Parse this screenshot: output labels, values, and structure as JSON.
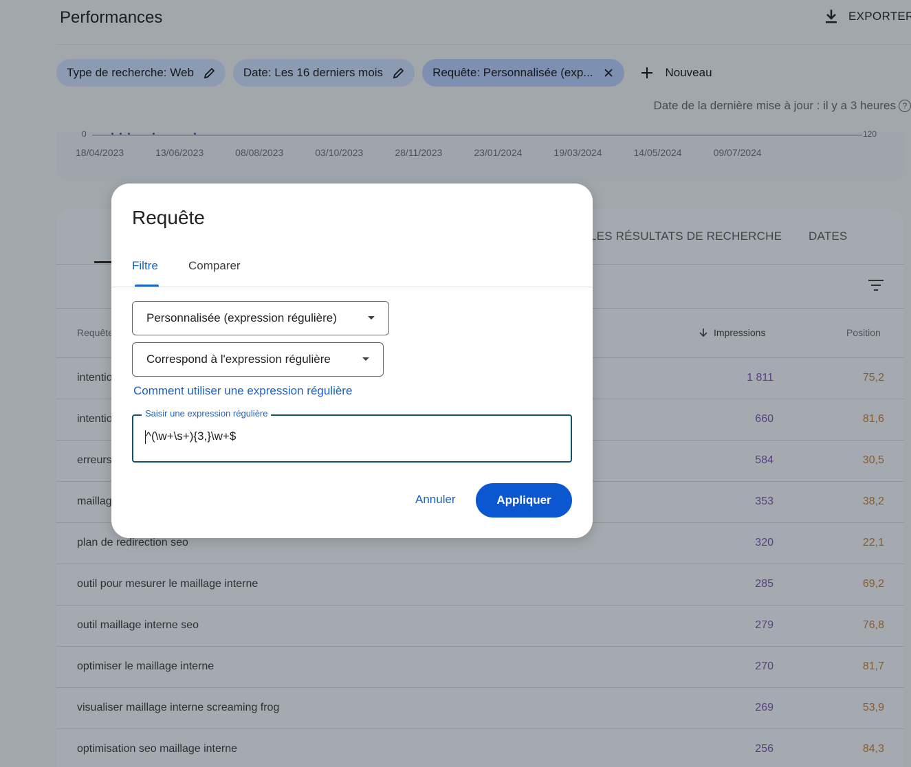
{
  "header": {
    "title": "Performances",
    "export_label": "EXPORTER"
  },
  "filters": {
    "chips": [
      {
        "label": "Type de recherche: Web",
        "icon": "pencil-icon"
      },
      {
        "label": "Date: Les 16 derniers mois",
        "icon": "pencil-icon"
      },
      {
        "label": "Requête: Personnalisée (exp...",
        "icon": "close-icon"
      }
    ],
    "add_label": "Nouveau"
  },
  "last_update": {
    "text": "Date de la dernière mise à jour : il y a 3 heures",
    "help": "?"
  },
  "chart": {
    "y_min_label": "0",
    "y_max_label": "120",
    "dates": [
      "18/04/2023",
      "13/06/2023",
      "08/08/2023",
      "03/10/2023",
      "28/11/2023",
      "23/01/2024",
      "19/03/2024",
      "14/05/2024",
      "09/07/2024"
    ]
  },
  "table": {
    "tabs": [
      "LES RÉSULTATS DE RECHERCHE",
      "DATES"
    ],
    "columns": {
      "query": "Requête",
      "impressions": "Impressions",
      "position": "Position"
    },
    "rows": [
      {
        "query": "intentio",
        "impressions": "1 811",
        "position": "75,2"
      },
      {
        "query": "intentio",
        "impressions": "660",
        "position": "81,6"
      },
      {
        "query": "erreurs",
        "impressions": "584",
        "position": "30,5"
      },
      {
        "query": "maillag",
        "impressions": "353",
        "position": "38,2"
      },
      {
        "query": "plan de redirection seo",
        "impressions": "320",
        "position": "22,1"
      },
      {
        "query": "outil pour mesurer le maillage interne",
        "impressions": "285",
        "position": "69,2"
      },
      {
        "query": "outil maillage interne seo",
        "impressions": "279",
        "position": "76,8"
      },
      {
        "query": "optimiser le maillage interne",
        "impressions": "270",
        "position": "81,7"
      },
      {
        "query": "visualiser maillage interne screaming frog",
        "impressions": "269",
        "position": "53,9"
      },
      {
        "query": "optimisation seo maillage interne",
        "impressions": "256",
        "position": "84,3"
      }
    ]
  },
  "dialog": {
    "title": "Requête",
    "tabs": {
      "filter": "Filtre",
      "compare": "Comparer"
    },
    "match_type": "Personnalisée (expression régulière)",
    "condition": "Correspond à l'expression régulière",
    "help_link": "Comment utiliser une expression régulière",
    "regex_field": {
      "label": "Saisir une expression régulière",
      "value": "^(\\w+\\s+){3,}\\w+$"
    },
    "cancel_label": "Annuler",
    "apply_label": "Appliquer"
  },
  "colors": {
    "primary": "#0b57d0",
    "link": "#1a64c6",
    "field_border": "#13526e",
    "overlay": "#a1a7ab"
  }
}
